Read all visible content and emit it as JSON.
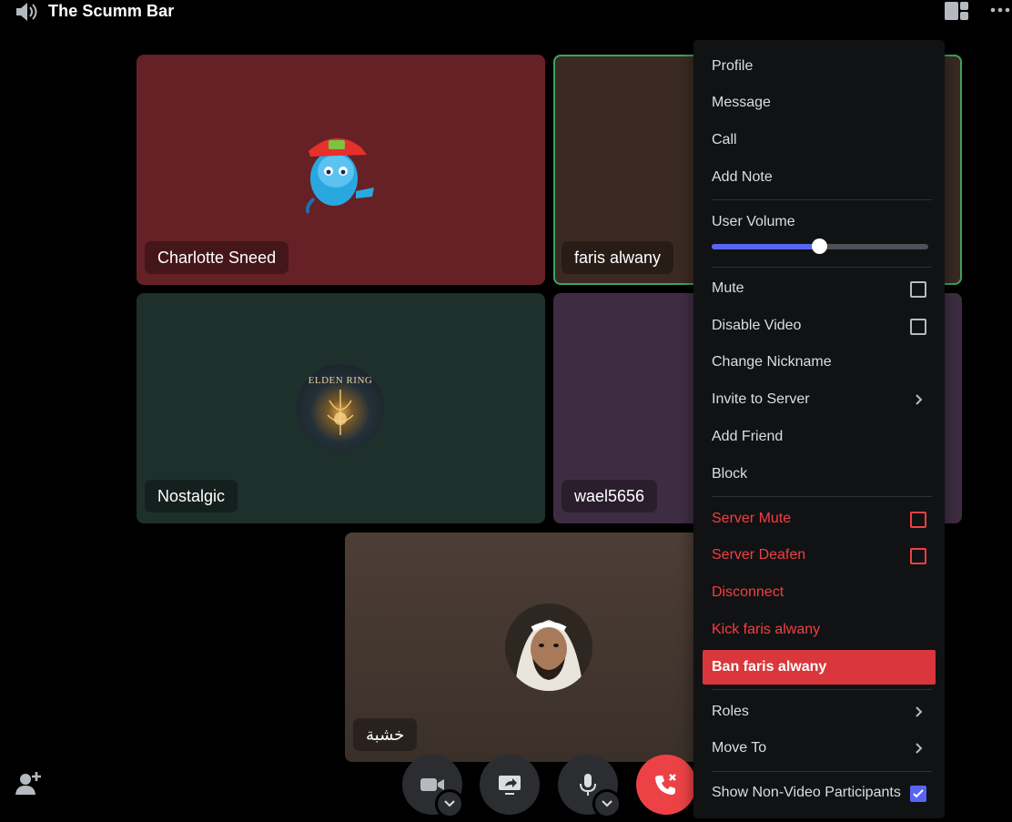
{
  "header": {
    "title": "The Scumm Bar",
    "icons": [
      "speaker-icon",
      "grid-layout-icon",
      "more-icon"
    ]
  },
  "tiles": [
    {
      "name": "Charlotte Sneed",
      "color": "#652125"
    },
    {
      "name": "faris alwany",
      "color": "#3b2a23",
      "speaking_outline": "#3ba55d"
    },
    {
      "name": "Nostalgic",
      "color": "#1e302c",
      "avatar_text": "ELDEN RING"
    },
    {
      "name": "wael5656",
      "color": "#3e2d42"
    },
    {
      "name": "خشبة",
      "color": "#4d3e36"
    }
  ],
  "call_controls": {
    "icons": [
      "camera-icon",
      "screen-share-icon",
      "microphone-icon",
      "end-call-icon"
    ],
    "end_color": "#ed4245"
  },
  "context_menu": {
    "items": {
      "profile": "Profile",
      "message": "Message",
      "call": "Call",
      "add_note": "Add Note",
      "user_volume": "User Volume",
      "mute": "Mute",
      "disable_video": "Disable Video",
      "change_nickname": "Change Nickname",
      "invite_to_server": "Invite to Server",
      "add_friend": "Add Friend",
      "block": "Block",
      "server_mute": "Server Mute",
      "server_deafen": "Server Deafen",
      "disconnect": "Disconnect",
      "kick": "Kick faris alwany",
      "ban": "Ban faris alwany",
      "roles": "Roles",
      "move_to": "Move To",
      "show_non_video": "Show Non-Video Participants"
    },
    "user_volume_fraction": 0.5,
    "show_non_video_checked": true,
    "mute_checked": false,
    "disable_video_checked": false,
    "server_mute_checked": false,
    "server_deafen_checked": false,
    "danger_color": "#f23f42",
    "accent_color": "#5865f2"
  }
}
